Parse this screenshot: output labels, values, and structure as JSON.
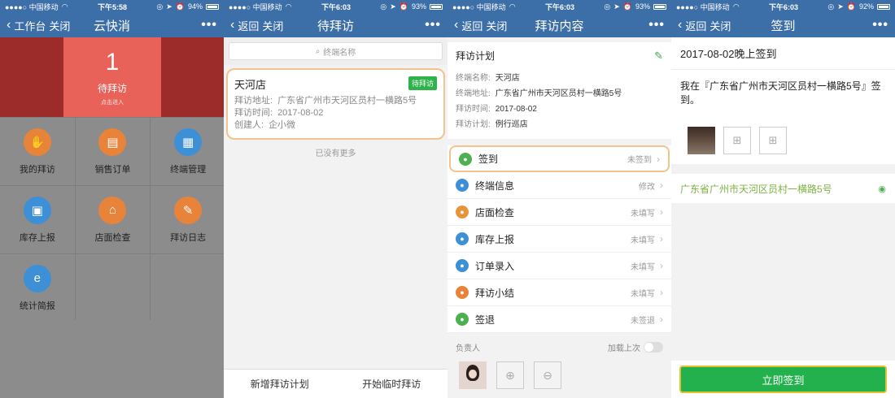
{
  "screen1": {
    "status": {
      "carrier": "●●●●○ 中国移动",
      "time": "下午5:58",
      "battery": "94%"
    },
    "nav": {
      "back": "工作台",
      "close": "关闭",
      "title": "云快消",
      "more": "•••"
    },
    "tile": {
      "count": "1",
      "label": "待拜访",
      "sub": "点击进入"
    },
    "grid": [
      {
        "label": "我的拜访",
        "color": "#e8843a",
        "icon": "handshake-icon",
        "glyph": "✋"
      },
      {
        "label": "销售订单",
        "color": "#e8843a",
        "icon": "clipboard-icon",
        "glyph": "▤"
      },
      {
        "label": "终端管理",
        "color": "#3d8fd6",
        "icon": "store-icon",
        "glyph": "▦"
      },
      {
        "label": "库存上报",
        "color": "#3d8fd6",
        "icon": "box-icon",
        "glyph": "▣"
      },
      {
        "label": "店面检查",
        "color": "#e8843a",
        "icon": "shop-icon",
        "glyph": "⌂"
      },
      {
        "label": "拜访日志",
        "color": "#e8843a",
        "icon": "note-icon",
        "glyph": "✎"
      },
      {
        "label": "统计简报",
        "color": "#3d8fd6",
        "icon": "stats-icon",
        "glyph": "e"
      }
    ]
  },
  "screen2": {
    "status": {
      "carrier": "●●●●○ 中国移动",
      "time": "下午6:03",
      "battery": "93%"
    },
    "nav": {
      "back": "返回",
      "close": "关闭",
      "title": "待拜访",
      "more": "•••"
    },
    "search_placeholder": "终端名称",
    "card": {
      "title": "天河店",
      "badge": "待拜访",
      "addr_label": "拜访地址:",
      "addr": "广东省广州市天河区员村一横路5号",
      "time_label": "拜访时间:",
      "time": "2017-08-02",
      "creator_label": "创建人:",
      "creator": "企小微"
    },
    "nomore": "已没有更多",
    "bottom": {
      "left": "新增拜访计划",
      "right": "开始临时拜访"
    }
  },
  "screen3": {
    "status": {
      "carrier": "●●●●○ 中国移动",
      "time": "下午6:03",
      "battery": "93%"
    },
    "nav": {
      "back": "返回",
      "close": "关闭",
      "title": "拜访内容",
      "more": "•••"
    },
    "plan": {
      "title": "拜访计划",
      "name_label": "终端名称:",
      "name": "天河店",
      "addr_label": "终端地址:",
      "addr": "广东省广州市天河区员村一横路5号",
      "time_label": "拜访时间:",
      "time": "2017-08-02",
      "plan_label": "拜访计划:",
      "plan": "例行巡店"
    },
    "rows": [
      {
        "label": "签到",
        "status": "未签到",
        "color": "#4caf50",
        "icon": "signin-icon"
      },
      {
        "label": "终端信息",
        "status": "修改",
        "color": "#3d8fd6",
        "icon": "info-icon"
      },
      {
        "label": "店面检查",
        "status": "未填写",
        "color": "#e8943a",
        "icon": "bulb-icon"
      },
      {
        "label": "库存上报",
        "status": "未填写",
        "color": "#3d8fd6",
        "icon": "box-icon"
      },
      {
        "label": "订单录入",
        "status": "未填写",
        "color": "#3d8fd6",
        "icon": "order-icon"
      },
      {
        "label": "拜访小结",
        "status": "未填写",
        "color": "#e8843a",
        "icon": "summary-icon"
      },
      {
        "label": "签退",
        "status": "未签退",
        "color": "#4caf50",
        "icon": "signout-icon"
      }
    ],
    "owner": {
      "label": "负责人",
      "toggle": "加载上次"
    }
  },
  "screen4": {
    "status": {
      "carrier": "●●●●○ 中国移动",
      "time": "下午6:03",
      "battery": "92%"
    },
    "nav": {
      "back": "返回",
      "close": "关闭",
      "title": "签到",
      "more": "•••"
    },
    "heading": "2017-08-02晚上签到",
    "message": "我在『广东省广州市天河区员村一横路5号』签到。",
    "address": "广东省广州市天河区员村一横路5号",
    "button": "立即签到"
  }
}
